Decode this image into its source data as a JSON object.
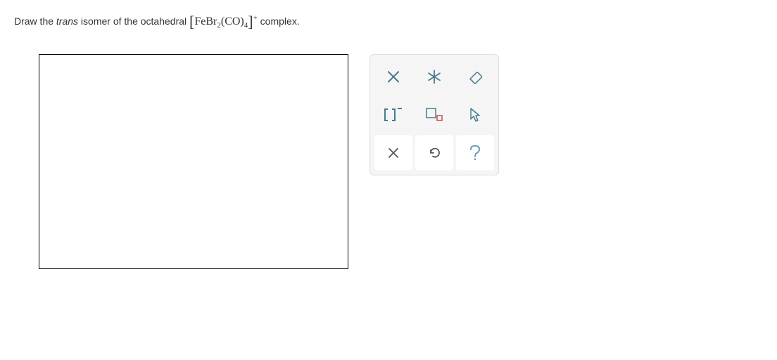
{
  "question": {
    "prefix": "Draw the ",
    "italic_word": "trans",
    "middle": " isomer of the octahedral ",
    "formula_parts": {
      "open": "[",
      "fe": "FeBr",
      "sub2": "2",
      "co": "(CO)",
      "sub4": "4",
      "close": "]",
      "charge": "+"
    },
    "suffix": " complex."
  },
  "tools": {
    "delete": "delete-tool",
    "center": "center-atom-tool",
    "eraser": "eraser-tool",
    "brackets": "brackets-tool",
    "boxes": "boxes-tool",
    "cursor": "cursor-tool",
    "clear": "clear-tool",
    "undo": "undo-tool",
    "help": "help-tool"
  }
}
